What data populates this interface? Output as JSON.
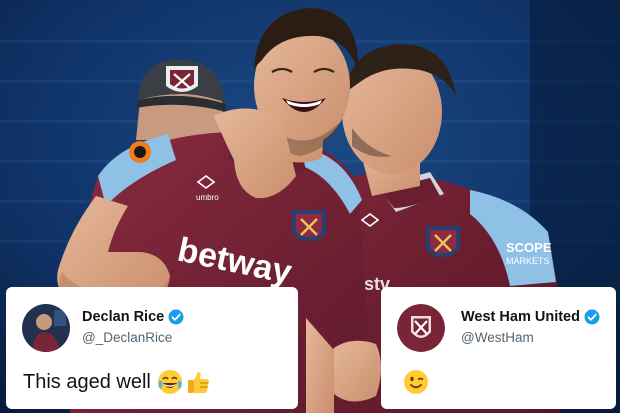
{
  "photo": {
    "shirt_sponsor": "betway",
    "sponsor_partial_right": "SCOPE MARKETS",
    "kit_brand": "umbro",
    "colors": {
      "claret": "#7a2438",
      "sky_blue": "#8fc0e6",
      "stadium_blue": "#0b2a55"
    }
  },
  "tweets": [
    {
      "display_name": "Declan Rice",
      "handle": "@_DeclanRice",
      "text": "This aged well",
      "emojis": [
        "face-with-tears-of-joy-emoji",
        "thumbs-up-emoji"
      ],
      "verified_color": "#1d9bf0"
    },
    {
      "display_name": "West Ham United",
      "handle": "@WestHam",
      "text": "",
      "emojis": [
        "winking-face-emoji"
      ],
      "verified_color": "#1d9bf0"
    }
  ]
}
